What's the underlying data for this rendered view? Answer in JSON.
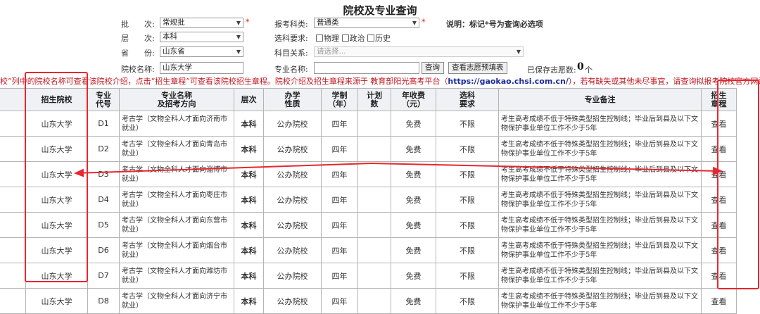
{
  "page_title": "院校及专业查询",
  "form": {
    "batch": {
      "label": "批　　次:",
      "value": "常规批"
    },
    "level": {
      "label": "层　　次:",
      "value": "本科"
    },
    "province": {
      "label": "省　　份:",
      "value": "山东省"
    },
    "school_name": {
      "label": "院校名称:",
      "value": "山东大学"
    },
    "exam_type": {
      "label": "报考科类:",
      "value": "普通类"
    },
    "subject_req": {
      "label": "选科要求:",
      "options": [
        "物理",
        "政治",
        "历史"
      ]
    },
    "subject_rel": {
      "label": "科目关系:",
      "placeholder": "请选择..."
    },
    "major_name": {
      "label": "专业名称:",
      "value": ""
    },
    "required_mark": "*",
    "note": "说明：标记*号为查询必选项",
    "query_button": "查询",
    "preview_button": "查看志愿预填表",
    "saved_label": "已保存志愿数:",
    "saved_count": "0",
    "saved_unit": "个"
  },
  "info_text": {
    "part1": "校”列中的院校名称可查看该院校介绍，点击“招生章程”可查看该院校招生章程。院校介绍及招生章程来源于 教育部阳光高考平台（",
    "url": "https://gaokao.chsi.com.cn/",
    "part2": "），若有缺失或其他未尽事宜，请查询拟报考院校官方网站。"
  },
  "table": {
    "headers": [
      "",
      "招生院校",
      "专业\n代号",
      "专业名称\n及招考方向",
      "层次",
      "办学\n性质",
      "学制\n（年）",
      "计划\n数",
      "年收费\n（元）",
      "选科\n要求",
      "专业备注",
      "招生\n章程"
    ],
    "rows": [
      {
        "school": "山东大学",
        "code": "D1",
        "major": "考古学（文物全科人才面向济南市就业）",
        "level": "本科",
        "nature": "公办院校",
        "years": "四年",
        "plan": "",
        "fee": "免费",
        "req": "不限",
        "remark": "考生高考成绩不低于特殊类型招生控制线；毕业后到县及以下文物保护事业单位工作不少于5年",
        "link": "查看"
      },
      {
        "school": "山东大学",
        "code": "D2",
        "major": "考古学（文物全科人才面向青岛市就业）",
        "level": "本科",
        "nature": "公办院校",
        "years": "四年",
        "plan": "",
        "fee": "免费",
        "req": "不限",
        "remark": "考生高考成绩不低于特殊类型招生控制线；毕业后到县及以下文物保护事业单位工作不少于5年",
        "link": "查看"
      },
      {
        "school": "山东大学",
        "code": "D3",
        "major": "考古学（文物全科人才面向淄博市就业）",
        "level": "本科",
        "nature": "公办院校",
        "years": "四年",
        "plan": "",
        "fee": "免费",
        "req": "不限",
        "remark": "考生高考成绩不低于特殊类型招生控制线；毕业后到县及以下文物保护事业单位工作不少于5年",
        "link": "查看"
      },
      {
        "school": "山东大学",
        "code": "D4",
        "major": "考古学（文物全科人才面向枣庄市就业）",
        "level": "本科",
        "nature": "公办院校",
        "years": "四年",
        "plan": "",
        "fee": "免费",
        "req": "不限",
        "remark": "考生高考成绩不低于特殊类型招生控制线；毕业后到县及以下文物保护事业单位工作不少于5年",
        "link": "查看"
      },
      {
        "school": "山东大学",
        "code": "D5",
        "major": "考古学（文物全科人才面向东营市就业）",
        "level": "本科",
        "nature": "公办院校",
        "years": "四年",
        "plan": "",
        "fee": "免费",
        "req": "不限",
        "remark": "考生高考成绩不低于特殊类型招生控制线；毕业后到县及以下文物保护事业单位工作不少于5年",
        "link": "查看"
      },
      {
        "school": "山东大学",
        "code": "D6",
        "major": "考古学（文物全科人才面向烟台市就业）",
        "level": "本科",
        "nature": "公办院校",
        "years": "四年",
        "plan": "",
        "fee": "免费",
        "req": "不限",
        "remark": "考生高考成绩不低于特殊类型招生控制线；毕业后到县及以下文物保护事业单位工作不少于5年",
        "link": "查看"
      },
      {
        "school": "山东大学",
        "code": "D7",
        "major": "考古学（文物全科人才面向潍坊市就业）",
        "level": "本科",
        "nature": "公办院校",
        "years": "四年",
        "plan": "",
        "fee": "免费",
        "req": "不限",
        "remark": "考生高考成绩不低于特殊类型招生控制线；毕业后到县及以下文物保护事业单位工作不少于5年",
        "link": "查看"
      },
      {
        "school": "山东大学",
        "code": "D8",
        "major": "考古学（文物全科人才面向济宁市就业）",
        "level": "本科",
        "nature": "公办院校",
        "years": "四年",
        "plan": "",
        "fee": "免费",
        "req": "不限",
        "remark": "考生高考成绩不低于特殊类型招生控制线；毕业后到县及以下文物保护事业单位工作不少于5年",
        "link": "查看"
      }
    ]
  },
  "colors": {
    "annotation_red": "#e8262f",
    "link_blue": "#3a53a6",
    "info_red": "#c0141e"
  }
}
